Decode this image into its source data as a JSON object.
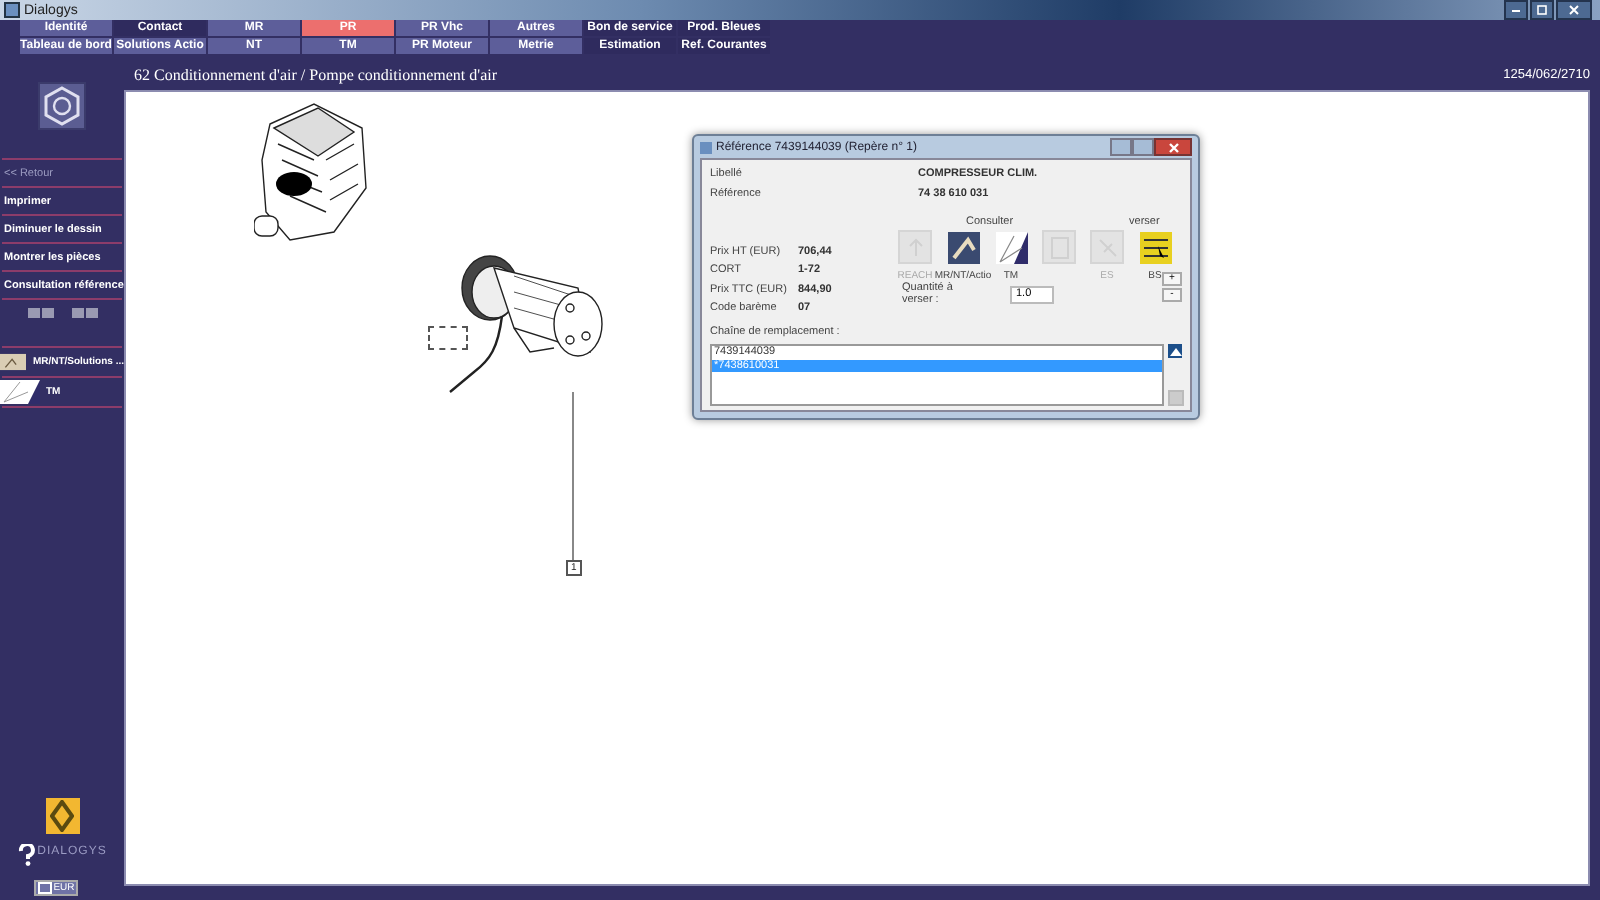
{
  "window": {
    "title": "Dialogys"
  },
  "nav": [
    [
      {
        "label": "Identité",
        "selected": false,
        "dark": false
      },
      {
        "label": "Contact",
        "selected": false,
        "dark": true
      },
      {
        "label": "MR",
        "selected": false,
        "dark": false
      },
      {
        "label": "PR",
        "selected": true,
        "dark": false
      },
      {
        "label": "PR Vhc",
        "selected": false,
        "dark": false
      },
      {
        "label": "Autres",
        "selected": false,
        "dark": false
      },
      {
        "label": "Bon de service",
        "selected": false,
        "dark": true
      },
      {
        "label": "Prod. Bleues",
        "selected": false,
        "dark": true
      }
    ],
    [
      {
        "label": "Tableau de bord",
        "selected": false,
        "dark": false
      },
      {
        "label": "Solutions Actio",
        "selected": false,
        "dark": false
      },
      {
        "label": "NT",
        "selected": false,
        "dark": false
      },
      {
        "label": "TM",
        "selected": false,
        "dark": false
      },
      {
        "label": "PR Moteur",
        "selected": false,
        "dark": false
      },
      {
        "label": "Metrie",
        "selected": false,
        "dark": false
      },
      {
        "label": "Estimation",
        "selected": false,
        "dark": true
      },
      {
        "label": "Ref. Courantes",
        "selected": false,
        "dark": true
      }
    ]
  ],
  "breadcrumb": "62 Conditionnement d'air / Pompe conditionnement d'air",
  "code": "1254/062/2710",
  "sidebar": {
    "back": {
      "label": "<< Retour",
      "disabled": true
    },
    "actions": [
      "Imprimer",
      "Diminuer le dessin",
      "Montrer les pièces",
      "Consultation référence"
    ],
    "documents": [
      {
        "label": "MR/NT/Solutions ...",
        "kind": "manual"
      },
      {
        "label": "TM",
        "kind": "chart"
      }
    ],
    "brand": "DIALOGYS",
    "currency": "EUR"
  },
  "diagram": {
    "callout": "1"
  },
  "dialog": {
    "title": "Référence 7439144039 (Repère n° 1)",
    "top_fields": [
      {
        "label": "Libellé",
        "value": "COMPRESSEUR CLIM."
      },
      {
        "label": "Référence",
        "value": "74 38 610 031"
      }
    ],
    "prices": [
      {
        "label": "Prix HT (EUR)",
        "value": "706,44"
      },
      {
        "label": "CORT",
        "value": "1-72"
      },
      {
        "label": "Prix TTC (EUR)",
        "value": "844,90"
      },
      {
        "label": "Code barème",
        "value": "07"
      }
    ],
    "consult_heading": "Consulter",
    "pour_heading": "verser",
    "tools": [
      {
        "label": "REACH",
        "kind": "reach",
        "disabled": true
      },
      {
        "label": "MR/NT/Actio",
        "kind": "manual",
        "disabled": false
      },
      {
        "label": "TM",
        "kind": "chart",
        "disabled": false
      },
      {
        "kind": "doc",
        "disabled": true
      },
      {
        "label": "ES",
        "kind": "es",
        "disabled": true
      },
      {
        "label": "BS",
        "kind": "bs",
        "disabled": false
      }
    ],
    "quantity": {
      "label": "Quantité à verser :",
      "value": "1.0",
      "plus": "+",
      "minus": "-"
    },
    "chain": {
      "label": "Chaîne de remplacement :",
      "items": [
        {
          "text": "7439144039",
          "selected": false
        },
        {
          "text": "*7438610031",
          "selected": true
        }
      ]
    }
  }
}
